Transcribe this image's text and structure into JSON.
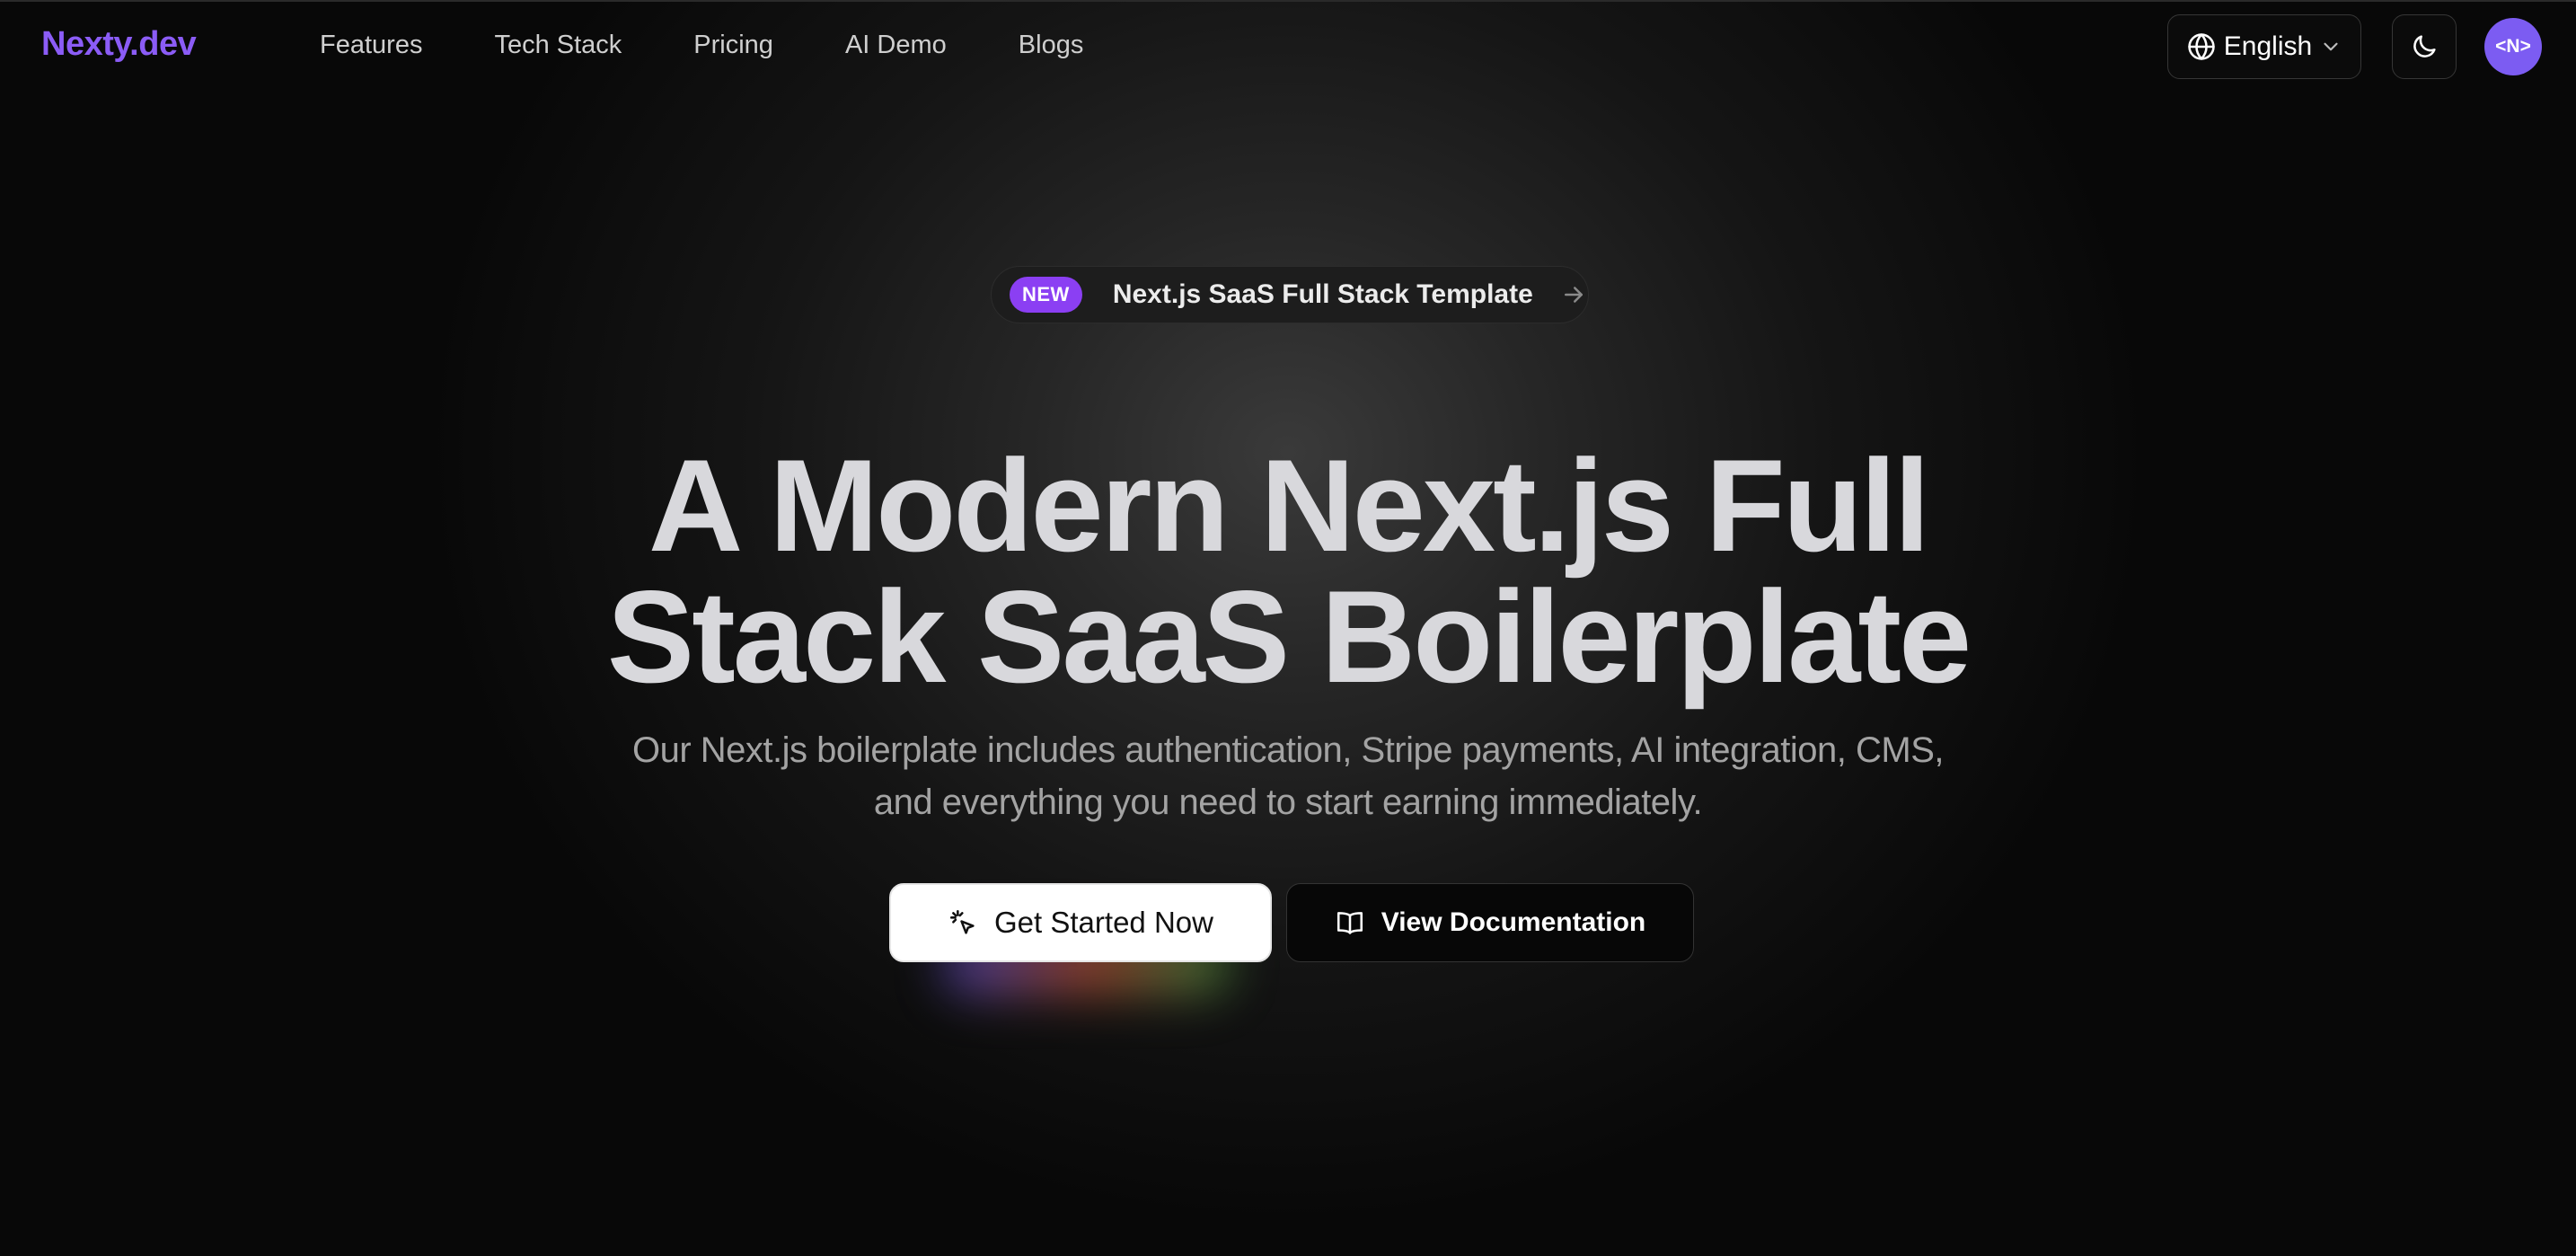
{
  "nav": {
    "brand": "Nexty.dev",
    "links": [
      {
        "label": "Features"
      },
      {
        "label": "Tech Stack"
      },
      {
        "label": "Pricing"
      },
      {
        "label": "AI Demo"
      },
      {
        "label": "Blogs"
      }
    ],
    "language": {
      "label": "English",
      "icon": "globe-icon",
      "chevron": "chevron-down-icon"
    },
    "theme_toggle": {
      "icon": "moon-icon"
    },
    "avatar": {
      "text": "<N>"
    }
  },
  "badge": {
    "tag": "NEW",
    "text": "Next.js SaaS Full Stack Template",
    "icon": "arrow-right-icon"
  },
  "hero": {
    "title_line1": "A Modern Next.js Full",
    "title_line2": "Stack SaaS Boilerplate",
    "subtitle": "Our Next.js boilerplate includes authentication, Stripe payments, AI integration, CMS, and everything you need to start earning immediately."
  },
  "actions": {
    "primary": {
      "label": "Get Started Now",
      "icon": "cursor-click-icon"
    },
    "secondary": {
      "label": "View Documentation",
      "icon": "book-open-icon"
    }
  },
  "colors": {
    "brand": "#8b5cf6",
    "new_tag": "#8b3ff3",
    "avatar": "#7c5cf2",
    "background": "#060606"
  }
}
